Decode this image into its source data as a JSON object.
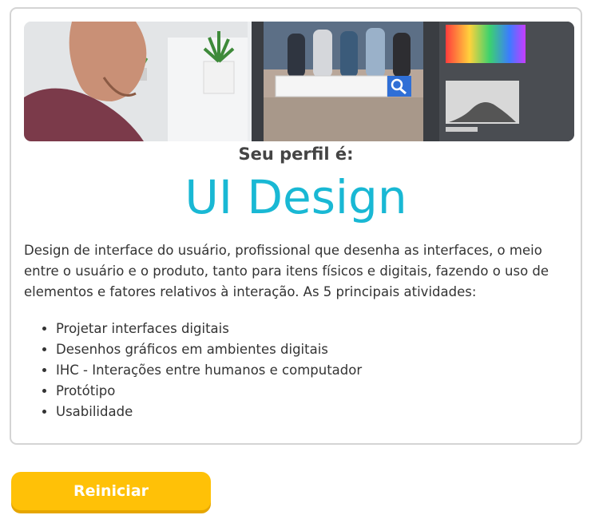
{
  "result": {
    "subtitle": "Seu perfil é:",
    "title": "UI Design",
    "description": "Design de interface do usuário, profissional que desenha as interfaces, o meio entre o usuário e o produto, tanto para itens físicos e digitais, fazendo o uso de elementos e fatores relativos à interação. As 5 principais atividades:",
    "activities": [
      "Projetar interfaces digitais",
      "Desenhos gráficos em ambientes digitais",
      "IHC - Interações entre humanos e computador",
      "Protótipo",
      "Usabilidade"
    ],
    "hero_icon": "designer-at-monitor-photo"
  },
  "actions": {
    "restart_label": "Reiniciar"
  },
  "colors": {
    "title": "#19b8d4",
    "button": "#ffc107",
    "border": "#d4d4d4"
  }
}
